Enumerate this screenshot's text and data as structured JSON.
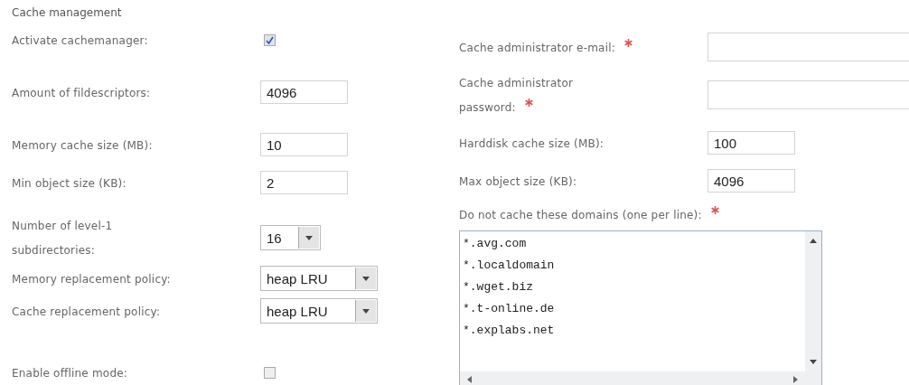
{
  "section_title": "Cache management",
  "left_fields": [
    {
      "kind": "checkbox",
      "label": "Activate cachemanager:",
      "checked": true
    },
    {
      "kind": "text",
      "label": "Amount of fildescriptors:",
      "value": "4096"
    },
    {
      "kind": "text",
      "label": "Memory cache size (MB):",
      "value": "10"
    },
    {
      "kind": "text",
      "label": "Min object size (KB):",
      "value": "2"
    },
    {
      "kind": "short_select",
      "label": "Number of level-1 subdirectories:",
      "value": "16"
    },
    {
      "kind": "select",
      "label": "Memory replacement policy:",
      "value": "heap LRU"
    },
    {
      "kind": "select",
      "label": "Cache replacement policy:",
      "value": "heap LRU"
    },
    {
      "kind": "checkbox",
      "label": "Enable offline mode:",
      "checked": false
    }
  ],
  "right_fields": [
    {
      "kind": "wide_text",
      "label": "Cache administrator e-mail:",
      "required": true
    },
    {
      "kind": "wide_text",
      "label": "Cache administrator password:",
      "required": true
    },
    {
      "kind": "text",
      "label": "Harddisk cache size (MB):",
      "required": false,
      "value": "100"
    },
    {
      "kind": "text",
      "label": "Max object size (KB):",
      "required": false,
      "value": "4096"
    }
  ],
  "domains": {
    "label": "Do not cache these domains (one per line):",
    "required": true,
    "lines": [
      "*.avg.com",
      "*.localdomain",
      "*.wget.biz",
      "*.t-online.de",
      "*.explabs.net"
    ]
  }
}
